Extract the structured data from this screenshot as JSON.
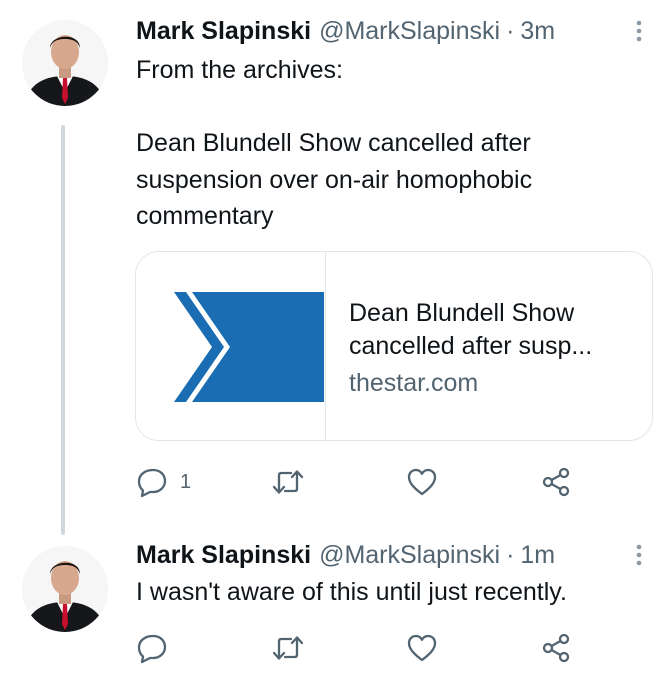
{
  "tweets": [
    {
      "author": {
        "name": "Mark Slapinski",
        "handle": "@MarkSlapinski"
      },
      "separator": "·",
      "time": "3m",
      "text": "From the archives:\n\nDean Blundell Show cancelled after suspension over on-air homophobic commentary",
      "card": {
        "title_line1": "Dean Blundell Show",
        "title_line2": "cancelled after susp...",
        "domain": "thestar.com",
        "brand_color": "#1a6db2"
      },
      "actions": {
        "reply_count": "1"
      }
    },
    {
      "author": {
        "name": "Mark Slapinski",
        "handle": "@MarkSlapinski"
      },
      "separator": "·",
      "time": "1m",
      "text": "I wasn't aware of this until just recently.",
      "actions": {
        "reply_count": ""
      }
    }
  ],
  "icons": [
    "avatar",
    "more-icon",
    "reply-icon",
    "retweet-icon",
    "like-icon",
    "share-icon"
  ],
  "colors": {
    "text": "#0f1419",
    "secondary": "#536471",
    "border": "#e1e6ea",
    "thread_line": "#cfd9de"
  }
}
